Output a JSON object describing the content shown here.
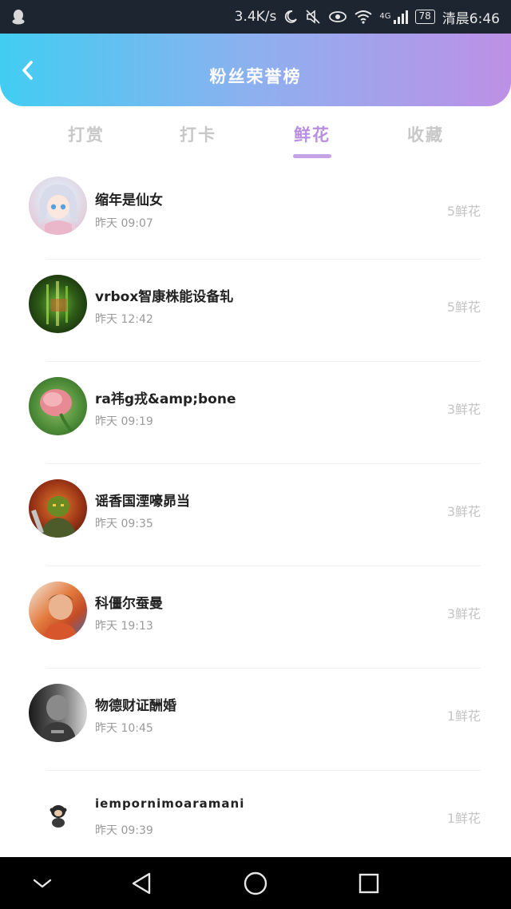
{
  "status_bar": {
    "speed": "3.4K/s",
    "network": "4G",
    "battery": "78",
    "time": "清晨6:46"
  },
  "header": {
    "title": "粉丝荣誉榜",
    "gradient": [
      "#41cdf2",
      "#bd90e6"
    ]
  },
  "tabs": [
    {
      "label": "打赏",
      "active": false
    },
    {
      "label": "打卡",
      "active": false
    },
    {
      "label": "鲜花",
      "active": true
    },
    {
      "label": "收藏",
      "active": false
    }
  ],
  "accent_color": "#b88fe0",
  "list": [
    {
      "name": "缩年是仙女",
      "time": "昨天 09:07",
      "count": "5鲜花",
      "avatar": "anime-girl-avatar"
    },
    {
      "name": "vrbox智康株能设备轧",
      "time": "昨天 12:42",
      "count": "5鲜花",
      "avatar": "green-lights-avatar"
    },
    {
      "name": "ra祎g戎&amp;bone",
      "time": "昨天 09:19",
      "count": "3鲜花",
      "avatar": "pink-flower-avatar"
    },
    {
      "name": "谣香国湮嚎昴当",
      "time": "昨天 09:35",
      "count": "3鲜花",
      "avatar": "orc-warrior-avatar"
    },
    {
      "name": "科僵尔蚕曼",
      "time": "昨天 19:13",
      "count": "3鲜花",
      "avatar": "child-photo-avatar"
    },
    {
      "name": "物德财证酬婚",
      "time": "昨天 10:45",
      "count": "1鲜花",
      "avatar": "grayscale-portrait-avatar"
    },
    {
      "name": "iempornimoaramani",
      "time": "昨天 09:39",
      "count": "1鲜花",
      "avatar": "monkey-sticker-avatar"
    }
  ]
}
